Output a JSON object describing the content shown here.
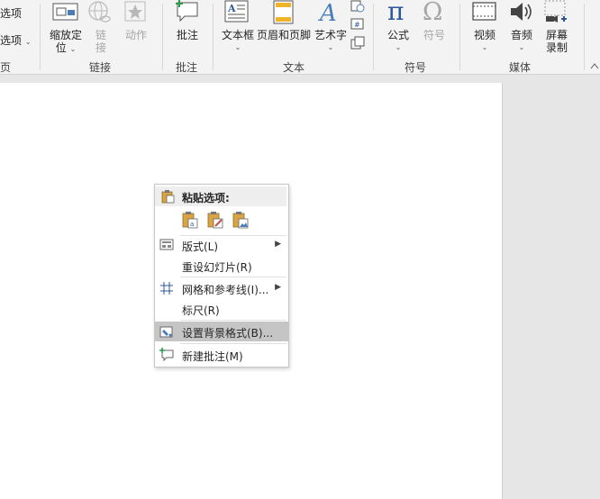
{
  "ribbon": {
    "partial_items": {
      "item1": "选项",
      "item2": "选项",
      "group0_tail": "页"
    },
    "link_group": {
      "zoom_position": {
        "line1": "缩放定",
        "line2": "位"
      },
      "link": {
        "line1": "链",
        "line2": "接"
      },
      "action": "动作",
      "label": "链接"
    },
    "comment_group": {
      "comment": "批注",
      "label": "批注"
    },
    "text_group": {
      "textbox": "文本框",
      "header_footer": "页眉和页脚",
      "wordart": "艺术字",
      "label": "文本"
    },
    "symbol_group": {
      "equation": "公式",
      "symbol": "符号",
      "label": "符号"
    },
    "media_group": {
      "video": "视频",
      "audio": "音频",
      "screen_record": {
        "line1": "屏幕",
        "line2": "录制"
      },
      "label": "媒体"
    }
  },
  "context_menu": {
    "paste_options": "粘贴选项:",
    "items": [
      {
        "label": "版式(L)",
        "has_submenu": true
      },
      {
        "label": "重设幻灯片(R)",
        "has_submenu": false
      },
      {
        "label": "网格和参考线(I)...",
        "has_submenu": true
      },
      {
        "label": "标尺(R)",
        "has_submenu": false
      },
      {
        "label": "设置背景格式(B)...",
        "has_submenu": false,
        "highlighted": true
      },
      {
        "label": "新建批注(M)",
        "has_submenu": false
      }
    ]
  },
  "colors": {
    "accent_blue": "#2b579a",
    "icon_blue": "#4a7ebb",
    "highlight": "#c5c5c5",
    "ribbon_bg": "#f3f3f3"
  }
}
